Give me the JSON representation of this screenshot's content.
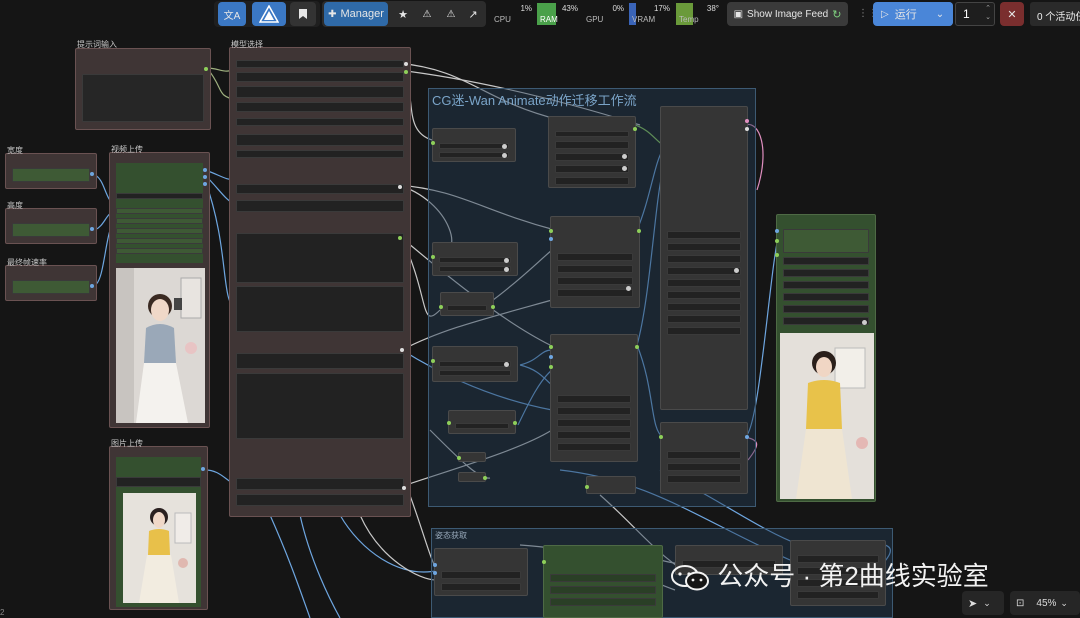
{
  "toolbar": {
    "translate_icon": "translate-icon",
    "logo_icon": "comfy-logo-icon",
    "bookmark_icon": "bookmark-icon",
    "manager_label": "Manager",
    "stats": [
      {
        "label": "CPU",
        "value": "1%"
      },
      {
        "label": "RAM",
        "value": "43%"
      },
      {
        "label": "GPU",
        "value": "0%"
      },
      {
        "label": "VRAM",
        "value": "17%"
      },
      {
        "label": "Temp",
        "value": "38°"
      }
    ],
    "image_feed_label": "Show Image Feed",
    "run_label": "运行",
    "run_count": "1",
    "active_label": "0 个活动任"
  },
  "groups": {
    "main_title": "CG迷-Wan Animate动作迁移工作流",
    "pose_title": "姿态获取"
  },
  "nodes": {
    "prompt_title": "提示词输入",
    "model_title": "模型选择",
    "video_upload_title": "视频上传",
    "image_upload_title": "图片上传",
    "width_title": "宽度",
    "height_title": "高度",
    "fps_title": "最终帧速率"
  },
  "watermark": "公众号 · 第2曲线实验室",
  "bottom": {
    "zoom": "45%",
    "corner": "2"
  },
  "colors": {
    "accent": "#3b78c4",
    "group_blue": "#2a4560",
    "node_green": "#34502f",
    "stop_red": "#7a2e2e"
  }
}
